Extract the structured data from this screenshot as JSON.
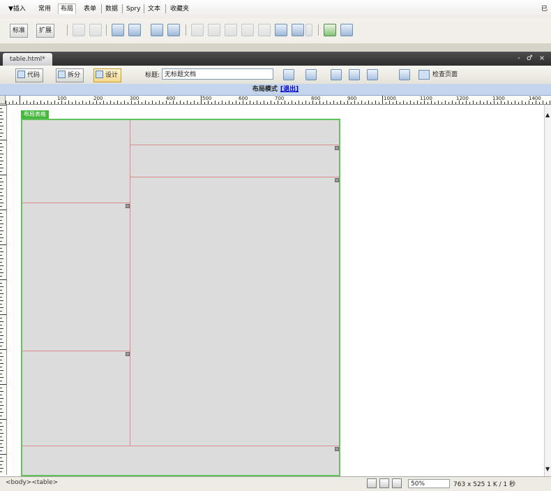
{
  "insert_bar": {
    "tabs": [
      "▼插入",
      "常用",
      "布局",
      "表单",
      "数据",
      "Spry",
      "文本",
      "收藏夹"
    ],
    "active_tab": "布局",
    "right_label": "已"
  },
  "layout_toolbar": {
    "standard_label": "标准",
    "expanded_label": "扩展"
  },
  "document": {
    "tab_label": "table.html*",
    "window_controls": "- ♂ ×"
  },
  "doc_toolbar": {
    "code_label": "代码",
    "split_label": "拆分",
    "design_label": "设计",
    "title_label": "标题:",
    "title_value": "无标题文档",
    "check_page_label": "检查页面"
  },
  "layout_mode": {
    "label": "布局模式",
    "exit_label": "[退出]"
  },
  "ruler": {
    "labels": [
      "100",
      "200",
      "300",
      "400",
      "500",
      "600",
      "700",
      "800",
      "900",
      "1000",
      "1100",
      "1200",
      "1300",
      "1400"
    ]
  },
  "layout_table": {
    "tab_label": "布局表格"
  },
  "status_bar": {
    "tag_selector": "<body><table>",
    "zoom_value": "50%",
    "dimensions": "763 x 525",
    "file_size": "1 K / 1 秒"
  },
  "colors": {
    "table_border": "#61c25c",
    "cell_border": "#d98c8c",
    "layout_bar": "#c3d4ec"
  }
}
